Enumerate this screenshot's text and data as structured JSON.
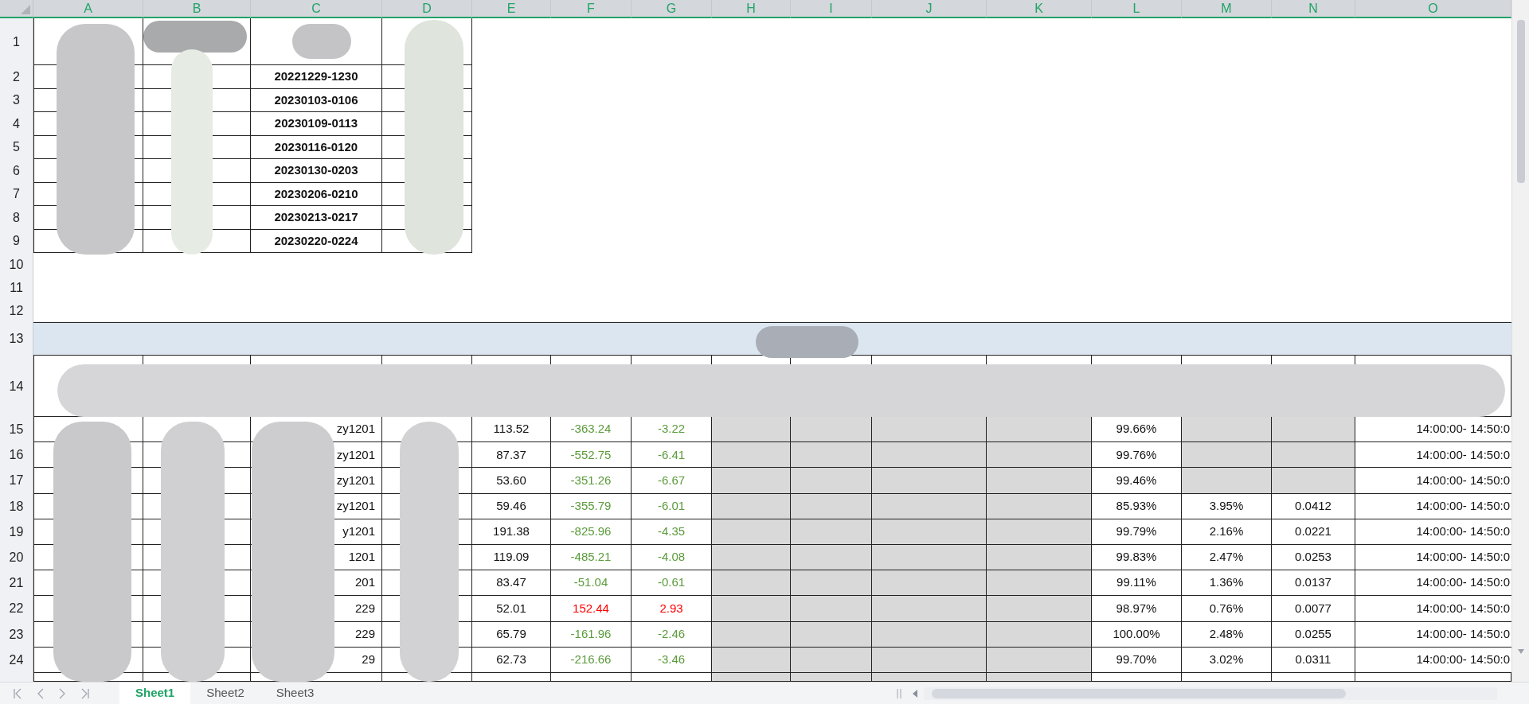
{
  "column_headers": [
    "A",
    "B",
    "C",
    "D",
    "E",
    "F",
    "G",
    "H",
    "I",
    "J",
    "K",
    "L",
    "M",
    "N",
    "O"
  ],
  "row_numbers": [
    "1",
    "2",
    "3",
    "4",
    "5",
    "6",
    "7",
    "8",
    "9",
    "10",
    "11",
    "12",
    "13",
    "14",
    "15",
    "16",
    "17",
    "18",
    "19",
    "20",
    "21",
    "22",
    "23",
    "24"
  ],
  "summary_table": {
    "periods": [
      "20221229-1230",
      "20230103-0106",
      "20230109-0113",
      "20230116-0120",
      "20230130-0203",
      "20230206-0210",
      "20230213-0217",
      "20230220-0224"
    ]
  },
  "detail_table": {
    "rows": [
      {
        "code_fragment": "zy1201",
        "col_e": "113.52",
        "col_f": {
          "text": "-363.24",
          "color": "#5b9b3b"
        },
        "col_g": {
          "text": "-3.22",
          "color": "#5b9b3b"
        },
        "col_l": "99.66%",
        "shaded_mn": true,
        "col_o": "14:00:00- 14:50:0"
      },
      {
        "code_fragment": "zy1201",
        "col_e": "87.37",
        "col_f": {
          "text": "-552.75",
          "color": "#5b9b3b"
        },
        "col_g": {
          "text": "-6.41",
          "color": "#5b9b3b"
        },
        "col_l": "99.76%",
        "shaded_mn": true,
        "col_o": "14:00:00- 14:50:0"
      },
      {
        "code_fragment": "zy1201",
        "col_e": "53.60",
        "col_f": {
          "text": "-351.26",
          "color": "#5b9b3b"
        },
        "col_g": {
          "text": "-6.67",
          "color": "#5b9b3b"
        },
        "col_l": "99.46%",
        "shaded_mn": true,
        "col_o": "14:00:00- 14:50:0"
      },
      {
        "code_fragment": "zy1201",
        "col_e": "59.46",
        "col_f": {
          "text": "-355.79",
          "color": "#5b9b3b"
        },
        "col_g": {
          "text": "-6.01",
          "color": "#5b9b3b"
        },
        "col_l": "85.93%",
        "col_m": "3.95%",
        "col_n": "0.0412",
        "shaded_mn": false,
        "col_o": "14:00:00- 14:50:0"
      },
      {
        "code_fragment": "y1201",
        "col_e": "191.38",
        "col_f": {
          "text": "-825.96",
          "color": "#5b9b3b"
        },
        "col_g": {
          "text": "-4.35",
          "color": "#5b9b3b"
        },
        "col_l": "99.79%",
        "col_m": "2.16%",
        "col_n": "0.0221",
        "shaded_mn": false,
        "col_o": "14:00:00- 14:50:0"
      },
      {
        "code_fragment": "1201",
        "col_e": "119.09",
        "col_f": {
          "text": "-485.21",
          "color": "#5b9b3b"
        },
        "col_g": {
          "text": "-4.08",
          "color": "#5b9b3b"
        },
        "col_l": "99.83%",
        "col_m": "2.47%",
        "col_n": "0.0253",
        "shaded_mn": false,
        "col_o": "14:00:00- 14:50:0"
      },
      {
        "code_fragment": "201",
        "col_e": "83.47",
        "col_f": {
          "text": "-51.04",
          "color": "#5b9b3b"
        },
        "col_g": {
          "text": "-0.61",
          "color": "#5b9b3b"
        },
        "col_l": "99.11%",
        "col_m": "1.36%",
        "col_n": "0.0137",
        "shaded_mn": false,
        "col_o": "14:00:00- 14:50:0"
      },
      {
        "code_fragment": "229",
        "col_e": "52.01",
        "col_f": {
          "text": "152.44",
          "color": "#ff0000"
        },
        "col_g": {
          "text": "2.93",
          "color": "#ff0000"
        },
        "col_l": "98.97%",
        "col_m": "0.76%",
        "col_n": "0.0077",
        "shaded_mn": false,
        "col_o": "14:00:00- 14:50:0"
      },
      {
        "code_fragment": "229",
        "col_e": "65.79",
        "col_f": {
          "text": "-161.96",
          "color": "#5b9b3b"
        },
        "col_g": {
          "text": "-2.46",
          "color": "#5b9b3b"
        },
        "col_l": "100.00%",
        "col_m": "2.48%",
        "col_n": "0.0255",
        "shaded_mn": false,
        "col_o": "14:00:00- 14:50:0"
      },
      {
        "code_fragment": "29",
        "col_e": "62.73",
        "col_f": {
          "text": "-216.66",
          "color": "#5b9b3b"
        },
        "col_g": {
          "text": "-3.46",
          "color": "#5b9b3b"
        },
        "col_l": "99.70%",
        "col_m": "3.02%",
        "col_n": "0.0311",
        "shaded_mn": false,
        "col_o": "14:00:00- 14:50:0"
      }
    ]
  },
  "sheet_tabs": [
    {
      "label": "Sheet1",
      "selected": true
    },
    {
      "label": "Sheet2",
      "selected": false
    },
    {
      "label": "Sheet3",
      "selected": false
    }
  ]
}
